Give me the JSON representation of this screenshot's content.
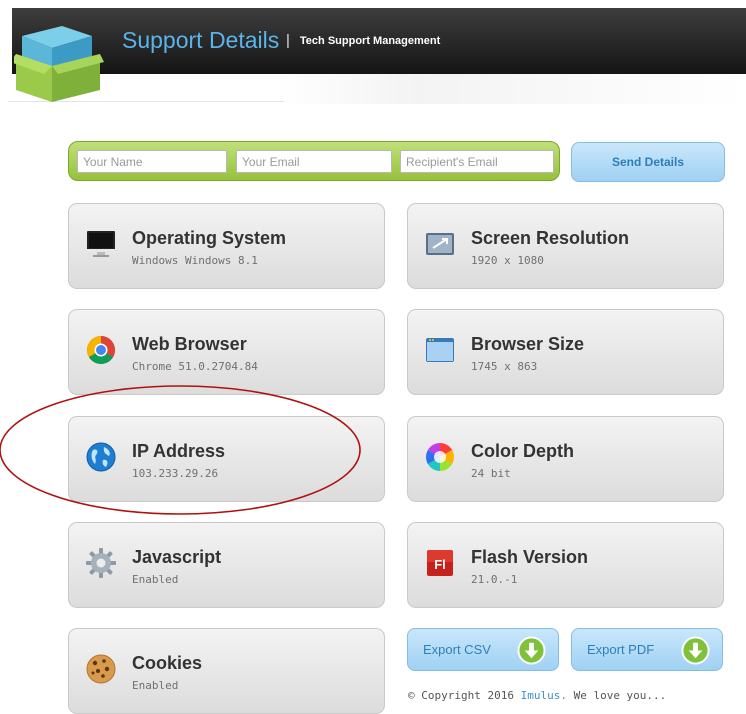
{
  "header": {
    "title": "Support Details",
    "separator": "|",
    "subtitle": "Tech Support Management"
  },
  "form": {
    "name_placeholder": "Your Name",
    "email_placeholder": "Your Email",
    "recipient_placeholder": "Recipient's Email",
    "send_label": "Send Details"
  },
  "cards": {
    "os": {
      "title": "Operating System",
      "value": "Windows Windows 8.1",
      "icon": "monitor-icon"
    },
    "resolution": {
      "title": "Screen Resolution",
      "value": "1920 x 1080",
      "icon": "screen-resolution-icon"
    },
    "browser": {
      "title": "Web Browser",
      "value": "Chrome 51.0.2704.84",
      "icon": "chrome-icon"
    },
    "browser_size": {
      "title": "Browser Size",
      "value": "1745 x 863",
      "icon": "browser-window-icon"
    },
    "ip": {
      "title": "IP Address",
      "value": "103.233.29.26",
      "icon": "globe-icon"
    },
    "color_depth": {
      "title": "Color Depth",
      "value": "24 bit",
      "icon": "color-wheel-icon"
    },
    "javascript": {
      "title": "Javascript",
      "value": "Enabled",
      "icon": "gear-icon"
    },
    "flash": {
      "title": "Flash Version",
      "value": "21.0.-1",
      "icon": "flash-icon"
    },
    "cookies": {
      "title": "Cookies",
      "value": "Enabled",
      "icon": "cookie-icon"
    }
  },
  "export": {
    "csv_label": "Export CSV",
    "pdf_label": "Export PDF"
  },
  "footer": {
    "copyright_prefix": "© Copyright 2016",
    "brand": "Imulus.",
    "suffix": "We love you..."
  },
  "colors": {
    "accent_blue": "#5ab4ea",
    "form_green": "#95c239",
    "download_green": "#7fc13a",
    "annotation_red": "#b01010"
  }
}
